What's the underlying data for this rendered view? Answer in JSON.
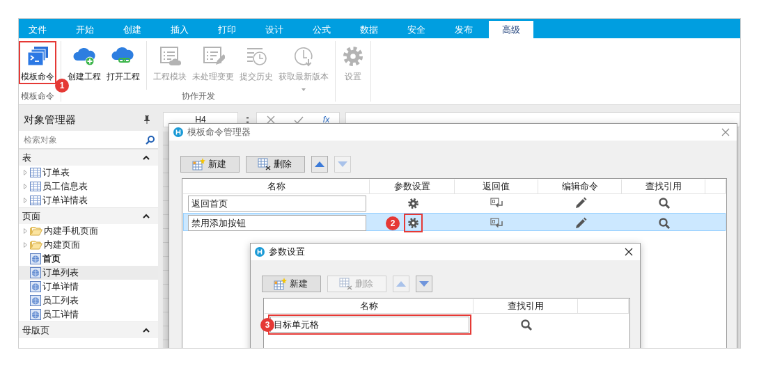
{
  "tabs": [
    {
      "label": "文件",
      "selected": false
    },
    {
      "label": "开始",
      "selected": false
    },
    {
      "label": "创建",
      "selected": false
    },
    {
      "label": "插入",
      "selected": false
    },
    {
      "label": "打印",
      "selected": false
    },
    {
      "label": "设计",
      "selected": false
    },
    {
      "label": "公式",
      "selected": false
    },
    {
      "label": "数据",
      "selected": false
    },
    {
      "label": "安全",
      "selected": false
    },
    {
      "label": "发布",
      "selected": false
    },
    {
      "label": "高级",
      "selected": true
    }
  ],
  "ribbon": {
    "groups": [
      {
        "label": "模板命令",
        "buttons": [
          {
            "label": "模板命令",
            "kind": "terminal",
            "disabled": false,
            "highlighted": true,
            "callout": "1"
          }
        ]
      },
      {
        "label": "协作开发",
        "buttons": [
          {
            "label": "创建工程",
            "kind": "cloud_add",
            "disabled": false
          },
          {
            "label": "打开工程",
            "kind": "cloud_link",
            "disabled": false
          },
          {
            "label": "工程模块",
            "kind": "list_cloud",
            "disabled": true,
            "separator_before": true
          },
          {
            "label": "未处理变更",
            "kind": "list_edit",
            "disabled": true
          },
          {
            "label": "提交历史",
            "kind": "list_clock",
            "disabled": true
          },
          {
            "label": "获取最新版本",
            "kind": "clock_down",
            "disabled": true,
            "dropdown": true
          }
        ]
      },
      {
        "buttons": [
          {
            "label": "设置",
            "kind": "gear",
            "disabled": true
          }
        ]
      }
    ]
  },
  "sidebar": {
    "title": "对象管理器",
    "search": {
      "placeholder": "检索对象"
    },
    "sections": [
      {
        "title": "表",
        "expanded": true,
        "items": [
          {
            "label": "订单表",
            "kind": "table",
            "expanded": false,
            "selected": false
          },
          {
            "label": "员工信息表",
            "kind": "table",
            "expanded": false,
            "selected": false
          },
          {
            "label": "订单详情表",
            "kind": "table",
            "expanded": false,
            "selected": false
          }
        ]
      },
      {
        "title": "页面",
        "expanded": true,
        "items": [
          {
            "label": "内建手机页面",
            "kind": "folder",
            "expanded": false,
            "selected": false
          },
          {
            "label": "内建页面",
            "kind": "folder",
            "expanded": false,
            "selected": false
          },
          {
            "label": "首页",
            "kind": "page",
            "start_page": true,
            "selected": false
          },
          {
            "label": "订单列表",
            "kind": "page",
            "selected": true
          },
          {
            "label": "订单详情",
            "kind": "page",
            "selected": false
          },
          {
            "label": "员工列表",
            "kind": "page",
            "selected": false
          },
          {
            "label": "员工详情",
            "kind": "page",
            "selected": false
          }
        ]
      },
      {
        "title": "母版页",
        "expanded": true
      }
    ]
  },
  "formula_bar": {
    "cell": "H4",
    "function_label": "fx"
  },
  "dialogs": [
    {
      "title": "模板命令管理器",
      "active": false,
      "toolbar": [
        {
          "kind": "new",
          "label": "新建",
          "disabled": false
        },
        {
          "kind": "delete",
          "label": "删除",
          "disabled": false
        },
        {
          "kind": "up",
          "disabled": false
        },
        {
          "kind": "down",
          "disabled": true
        }
      ],
      "columns": [
        {
          "label": "名称",
          "kind": "text"
        },
        {
          "label": "参数设置",
          "kind": "gear"
        },
        {
          "label": "返回值",
          "kind": "return"
        },
        {
          "label": "编辑命令",
          "kind": "pencil"
        },
        {
          "label": "查找引用",
          "kind": "search"
        }
      ],
      "rows": [
        {
          "name": "返回首页",
          "selected": false
        },
        {
          "name": "禁用添加按钮",
          "selected": true,
          "callout": {
            "text": "2",
            "kind": "gear"
          }
        }
      ]
    },
    {
      "title": "参数设置",
      "active": true,
      "toolbar": [
        {
          "kind": "new",
          "label": "新建",
          "disabled": false
        },
        {
          "kind": "delete",
          "label": "删除",
          "disabled": true
        },
        {
          "kind": "up",
          "disabled": true
        },
        {
          "kind": "down",
          "disabled": false
        }
      ],
      "columns": [
        {
          "label": "名称",
          "kind": "text"
        },
        {
          "label": "查找引用",
          "kind": "search"
        }
      ],
      "rows": [
        {
          "name": "目标单元格",
          "selected": false,
          "callout": {
            "text": "3",
            "kind": "text"
          }
        }
      ]
    }
  ]
}
